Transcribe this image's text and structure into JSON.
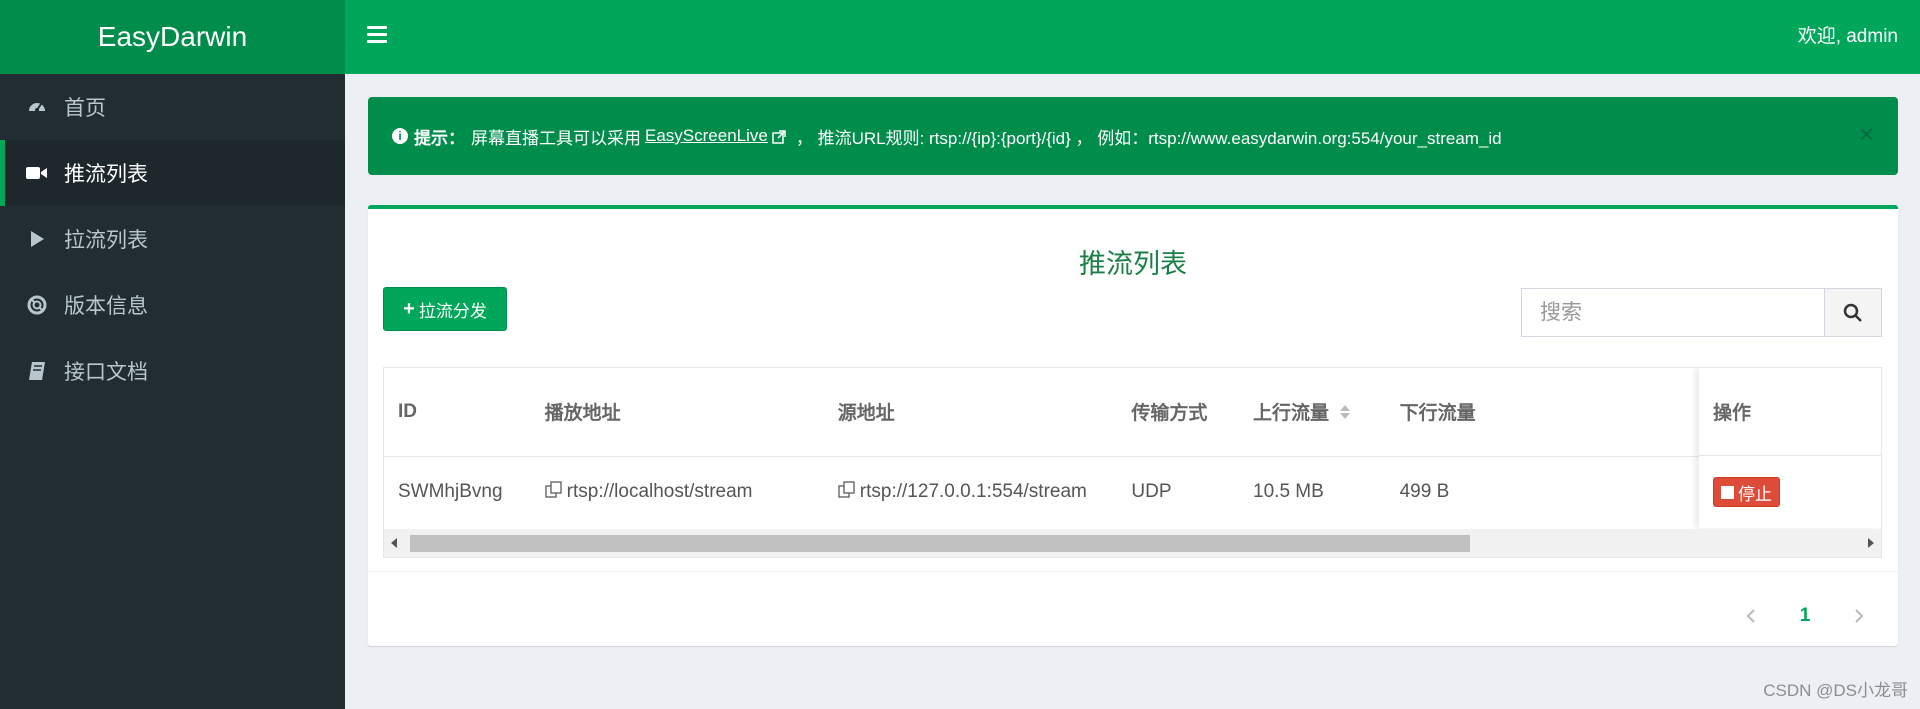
{
  "header": {
    "brand": "EasyDarwin",
    "welcome": "欢迎, admin"
  },
  "sidebar": {
    "items": [
      {
        "label": "首页",
        "icon": "dashboard-icon"
      },
      {
        "label": "推流列表",
        "icon": "video-camera-icon",
        "active": true
      },
      {
        "label": "拉流列表",
        "icon": "play-icon"
      },
      {
        "label": "版本信息",
        "icon": "life-ring-icon"
      },
      {
        "label": "接口文档",
        "icon": "book-icon"
      }
    ]
  },
  "alert": {
    "prefix": "提示：",
    "text1": "屏幕直播工具可以采用",
    "link": "EasyScreenLive",
    "text2": "， 推流URL规则: rtsp://{ip}:{port}/{id} ， 例如：rtsp://www.easydarwin.org:554/your_stream_id",
    "close": "×"
  },
  "box": {
    "title": "推流列表",
    "add_button": "拉流分发",
    "search_placeholder": "搜索"
  },
  "table": {
    "headers": [
      "ID",
      "播放地址",
      "源地址",
      "传输方式",
      "上行流量",
      "下行流量"
    ],
    "op_header": "操作",
    "rows": [
      {
        "id": "SWMhjBvng",
        "play_url": "rtsp://localhost/stream",
        "source_url": "rtsp://127.0.0.1:554/stream",
        "transport": "UDP",
        "upstream": "10.5 MB",
        "downstream": "499 B",
        "action": "停止"
      }
    ]
  },
  "pagination": {
    "current": "1"
  },
  "watermark": "CSDN @DS小龙哥",
  "colors": {
    "brand_dark": "#008d4c",
    "brand": "#00a65a",
    "sidebar": "#222d32",
    "danger": "#dd4b39"
  }
}
